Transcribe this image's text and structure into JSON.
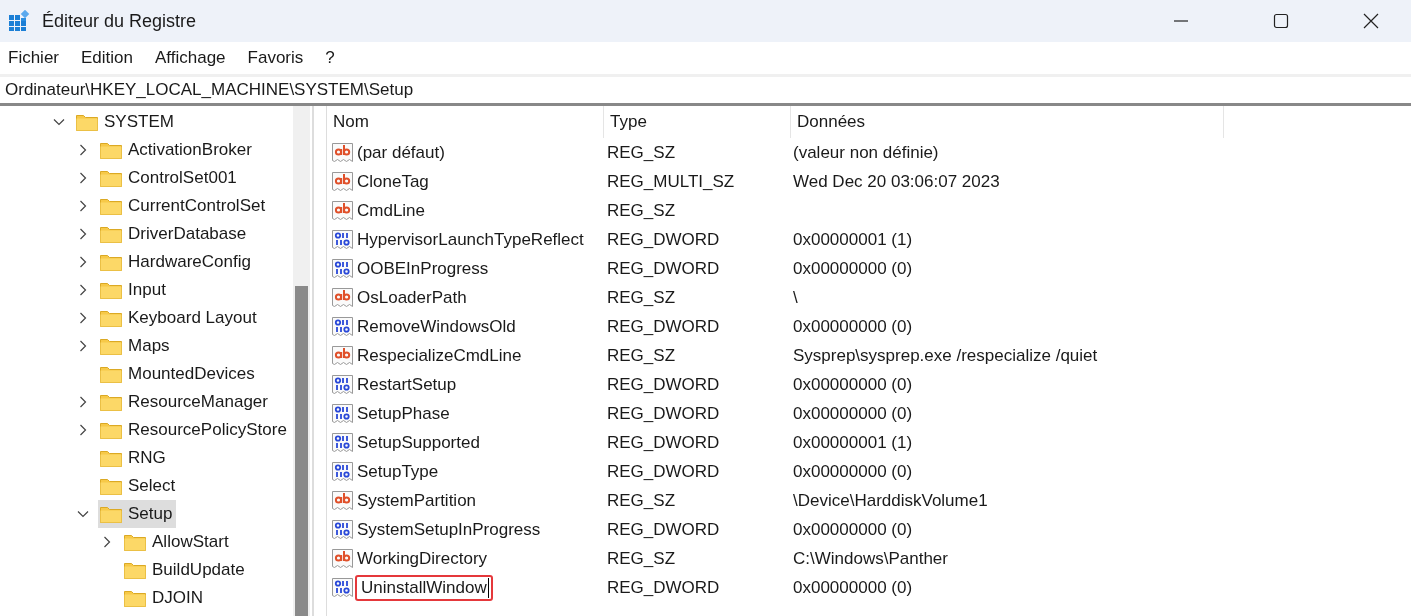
{
  "window": {
    "title": "Éditeur du Registre"
  },
  "menu": [
    "Fichier",
    "Edition",
    "Affichage",
    "Favoris",
    "?"
  ],
  "address": "Ordinateur\\HKEY_LOCAL_MACHINE\\SYSTEM\\Setup",
  "tree": [
    {
      "label": "SYSTEM",
      "expandable": true,
      "expanded": true,
      "selected": false,
      "children": [
        {
          "label": "ActivationBroker",
          "expandable": true,
          "expanded": false,
          "selected": false
        },
        {
          "label": "ControlSet001",
          "expandable": true,
          "expanded": false,
          "selected": false
        },
        {
          "label": "CurrentControlSet",
          "expandable": true,
          "expanded": false,
          "selected": false
        },
        {
          "label": "DriverDatabase",
          "expandable": true,
          "expanded": false,
          "selected": false
        },
        {
          "label": "HardwareConfig",
          "expandable": true,
          "expanded": false,
          "selected": false
        },
        {
          "label": "Input",
          "expandable": true,
          "expanded": false,
          "selected": false
        },
        {
          "label": "Keyboard Layout",
          "expandable": true,
          "expanded": false,
          "selected": false
        },
        {
          "label": "Maps",
          "expandable": true,
          "expanded": false,
          "selected": false
        },
        {
          "label": "MountedDevices",
          "expandable": false,
          "expanded": false,
          "selected": false
        },
        {
          "label": "ResourceManager",
          "expandable": true,
          "expanded": false,
          "selected": false
        },
        {
          "label": "ResourcePolicyStore",
          "expandable": true,
          "expanded": false,
          "selected": false
        },
        {
          "label": "RNG",
          "expandable": false,
          "expanded": false,
          "selected": false
        },
        {
          "label": "Select",
          "expandable": false,
          "expanded": false,
          "selected": false
        },
        {
          "label": "Setup",
          "expandable": true,
          "expanded": true,
          "selected": true,
          "children": [
            {
              "label": "AllowStart",
              "expandable": true,
              "expanded": false,
              "selected": false
            },
            {
              "label": "BuildUpdate",
              "expandable": false,
              "expanded": false,
              "selected": false
            },
            {
              "label": "DJOIN",
              "expandable": false,
              "expanded": false,
              "selected": false
            }
          ]
        }
      ]
    }
  ],
  "table": {
    "columns": [
      "Nom",
      "Type",
      "Données"
    ],
    "rows": [
      {
        "kind": "string",
        "name": "(par défaut)",
        "type": "REG_SZ",
        "data": "(valeur non définie)",
        "editing": false
      },
      {
        "kind": "string",
        "name": "CloneTag",
        "type": "REG_MULTI_SZ",
        "data": "Wed Dec 20 03:06:07 2023",
        "editing": false
      },
      {
        "kind": "string",
        "name": "CmdLine",
        "type": "REG_SZ",
        "editing": false
      },
      {
        "kind": "binary",
        "name": "HypervisorLaunchTypeReflect",
        "type": "REG_DWORD",
        "data": "0x00000001 (1)",
        "editing": false
      },
      {
        "kind": "binary",
        "name": "OOBEInProgress",
        "type": "REG_DWORD",
        "data": "0x00000000 (0)",
        "editing": false
      },
      {
        "kind": "string",
        "name": "OsLoaderPath",
        "type": "REG_SZ",
        "data": "\\",
        "editing": false
      },
      {
        "kind": "binary",
        "name": "RemoveWindowsOld",
        "type": "REG_DWORD",
        "data": "0x00000000 (0)",
        "editing": false
      },
      {
        "kind": "string",
        "name": "RespecializeCmdLine",
        "type": "REG_SZ",
        "data": "Sysprep\\sysprep.exe /respecialize /quiet",
        "editing": false
      },
      {
        "kind": "binary",
        "name": "RestartSetup",
        "type": "REG_DWORD",
        "data": "0x00000000 (0)",
        "editing": false
      },
      {
        "kind": "binary",
        "name": "SetupPhase",
        "type": "REG_DWORD",
        "data": "0x00000000 (0)",
        "editing": false
      },
      {
        "kind": "binary",
        "name": "SetupSupported",
        "type": "REG_DWORD",
        "data": "0x00000001 (1)",
        "editing": false
      },
      {
        "kind": "binary",
        "name": "SetupType",
        "type": "REG_DWORD",
        "data": "0x00000000 (0)",
        "editing": false
      },
      {
        "kind": "string",
        "name": "SystemPartition",
        "type": "REG_SZ",
        "data": "\\Device\\HarddiskVolume1",
        "editing": false
      },
      {
        "kind": "binary",
        "name": "SystemSetupInProgress",
        "type": "REG_DWORD",
        "data": "0x00000000 (0)",
        "editing": false
      },
      {
        "kind": "string",
        "name": "WorkingDirectory",
        "type": "REG_SZ",
        "data": "C:\\Windows\\Panther",
        "editing": false
      },
      {
        "kind": "binary",
        "name": "UninstallWindow",
        "type": "REG_DWORD",
        "data": "0x00000000 (0)",
        "editing": true
      }
    ]
  }
}
